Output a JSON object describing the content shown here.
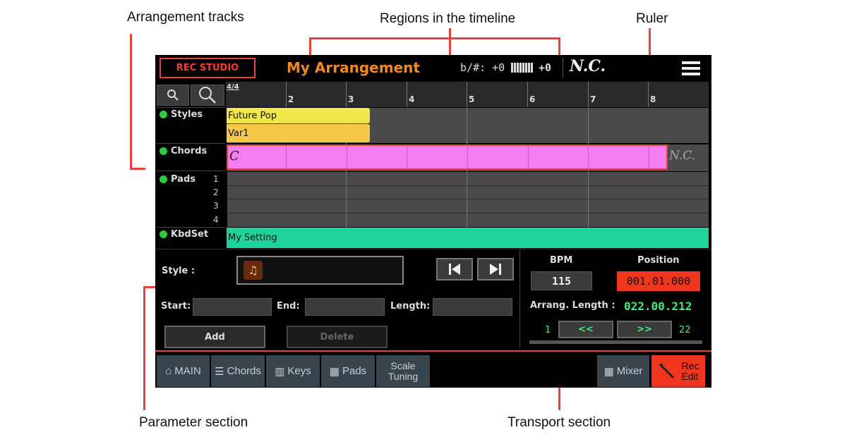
{
  "callouts": {
    "tracks": "Arrangement tracks",
    "regions": "Regions in the timeline",
    "ruler": "Ruler",
    "parameter": "Parameter section",
    "transport": "Transport section"
  },
  "header": {
    "rec_studio": "REC STUDIO",
    "title": "My Arrangement",
    "transpose": "b/#: +0",
    "octave": "+0",
    "chord": "N.C.",
    "menu_icon": "menu-icon"
  },
  "ruler": {
    "time_signature": "4/4",
    "measures": [
      "2",
      "3",
      "4",
      "5",
      "6",
      "7",
      "8"
    ]
  },
  "tracks": {
    "styles": "Styles",
    "chords": "Chords",
    "pads": "Pads",
    "pad_numbers": [
      "1",
      "2",
      "3",
      "4"
    ],
    "kbdset": "KbdSet"
  },
  "regions": {
    "style": "Future Pop",
    "variation": "Var1",
    "chord": "C",
    "chord_end": "N.C.",
    "kbdset": "My Setting"
  },
  "params": {
    "style_label": "Style :",
    "start_label": "Start:",
    "end_label": "End:",
    "length_label": "Length:",
    "add": "Add",
    "delete": "Delete",
    "style_icon": "music-note-icon"
  },
  "transport": {
    "bpm_label": "BPM",
    "bpm": "115",
    "position_label": "Position",
    "position": "001.01.000",
    "arrang_length_label": "Arrang. Length :",
    "arrang_length": "022.00.212",
    "first_measure": "1",
    "last_measure": "22",
    "prev": "<<",
    "next": ">>"
  },
  "tabs": {
    "main": "MAIN",
    "chords": "Chords",
    "keys": "Keys",
    "pads": "Pads",
    "scale": "Scale",
    "tuning": "Tuning",
    "mixer": "Mixer",
    "rec": "Rec",
    "edit": "Edit"
  },
  "colors": {
    "accent_red": "#e8433a",
    "title_orange": "#f08a1e",
    "style_region": "#f0e84a",
    "variation_region": "#f5c84a",
    "chord_region": "#f47ef0",
    "kbdset_region": "#1ed49a",
    "position_bg": "#f0361e",
    "length_green": "#3cf07a"
  }
}
